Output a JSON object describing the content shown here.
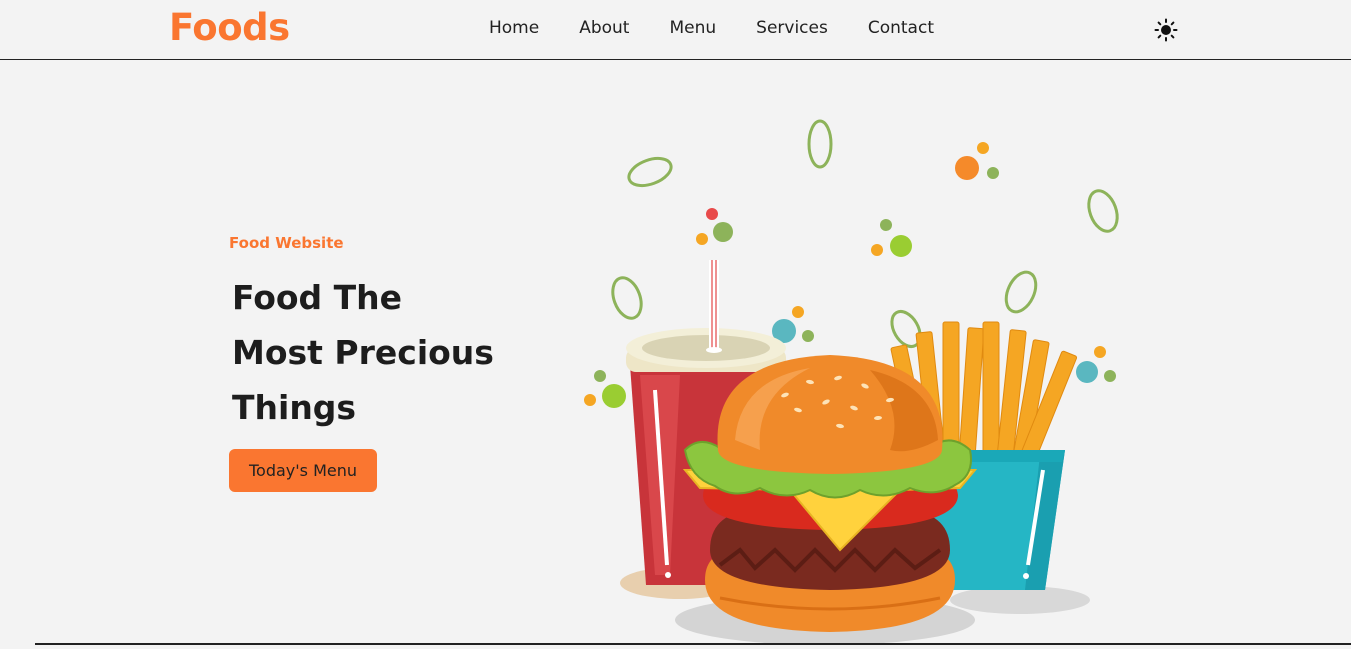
{
  "header": {
    "logo": "Foods",
    "nav": [
      "Home",
      "About",
      "Menu",
      "Services",
      "Contact"
    ],
    "theme_icon": "sun-icon"
  },
  "hero": {
    "subtitle": "Food Website",
    "title_lines": [
      "Food The",
      "Most Precious",
      "Things"
    ],
    "button_label": "Today's Menu"
  },
  "colors": {
    "accent": "#fa7630",
    "background": "#f3f3f3",
    "text": "#1d1d1d"
  },
  "illustration": {
    "name": "burger-fries-drink-illustration"
  }
}
